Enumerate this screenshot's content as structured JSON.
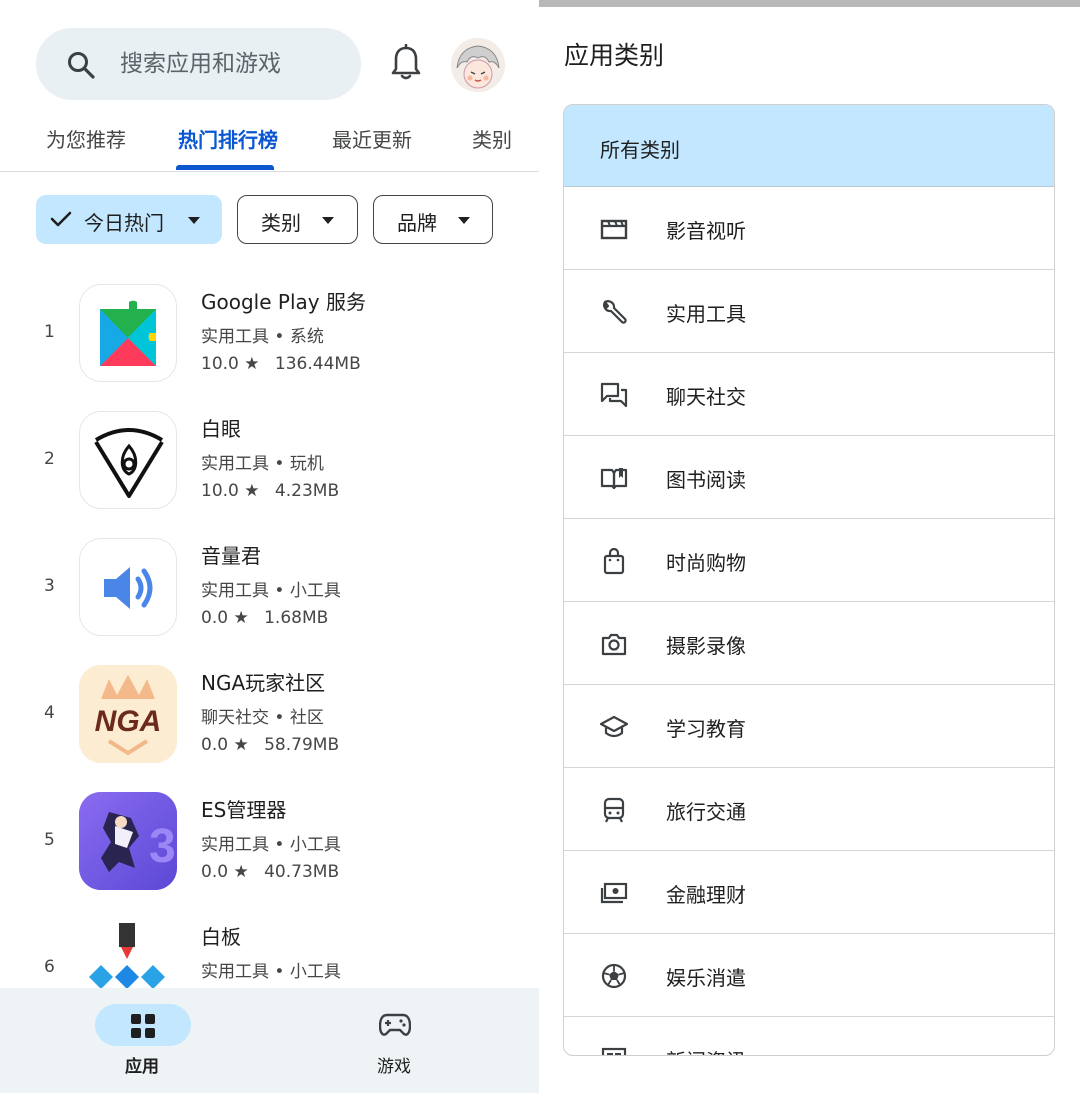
{
  "search": {
    "placeholder": "搜索应用和游戏"
  },
  "tabs": [
    {
      "label": "为您推荐"
    },
    {
      "label": "热门排行榜"
    },
    {
      "label": "最近更新"
    },
    {
      "label": "类别"
    }
  ],
  "filters": {
    "today_hot": "今日热门",
    "category": "类别",
    "brand": "品牌"
  },
  "apps": [
    {
      "rank": "1",
      "name": "Google Play 服务",
      "category": "实用工具 • 系统",
      "rating": "10.0",
      "size": "136.44MB",
      "icon": "google-play-services-icon"
    },
    {
      "rank": "2",
      "name": "白眼",
      "category": "实用工具 • 玩机",
      "rating": "10.0",
      "size": "4.23MB",
      "icon": "baiyan-icon"
    },
    {
      "rank": "3",
      "name": "音量君",
      "category": "实用工具 • 小工具",
      "rating": "0.0",
      "size": "1.68MB",
      "icon": "volume-icon"
    },
    {
      "rank": "4",
      "name": "NGA玩家社区",
      "category": "聊天社交 • 社区",
      "rating": "0.0",
      "size": "58.79MB",
      "icon": "nga-icon"
    },
    {
      "rank": "5",
      "name": "ES管理器",
      "category": "实用工具 • 小工具",
      "rating": "0.0",
      "size": "40.73MB",
      "icon": "es-manager-icon"
    },
    {
      "rank": "6",
      "name": "白板",
      "category": "实用工具 • 小工具",
      "rating": "",
      "size": "",
      "icon": "whiteboard-icon"
    }
  ],
  "bottom_nav": {
    "apps": "应用",
    "games": "游戏"
  },
  "categories_panel": {
    "title": "应用类别",
    "all": "所有类别",
    "items": [
      {
        "label": "影音视听",
        "icon": "clapperboard-icon"
      },
      {
        "label": "实用工具",
        "icon": "wrench-icon"
      },
      {
        "label": "聊天社交",
        "icon": "chat-icon"
      },
      {
        "label": "图书阅读",
        "icon": "book-icon"
      },
      {
        "label": "时尚购物",
        "icon": "shopping-bag-icon"
      },
      {
        "label": "摄影录像",
        "icon": "camera-icon"
      },
      {
        "label": "学习教育",
        "icon": "graduation-cap-icon"
      },
      {
        "label": "旅行交通",
        "icon": "train-icon"
      },
      {
        "label": "金融理财",
        "icon": "money-icon"
      },
      {
        "label": "娱乐消遣",
        "icon": "soccer-ball-icon"
      },
      {
        "label": "新闻资讯",
        "icon": "newspaper-icon"
      }
    ]
  },
  "colors": {
    "accent": "#0b57d0",
    "chip_selected": "#c2e7ff",
    "search_bg": "#e8f0f4",
    "nav_bg": "#eef4f6"
  }
}
